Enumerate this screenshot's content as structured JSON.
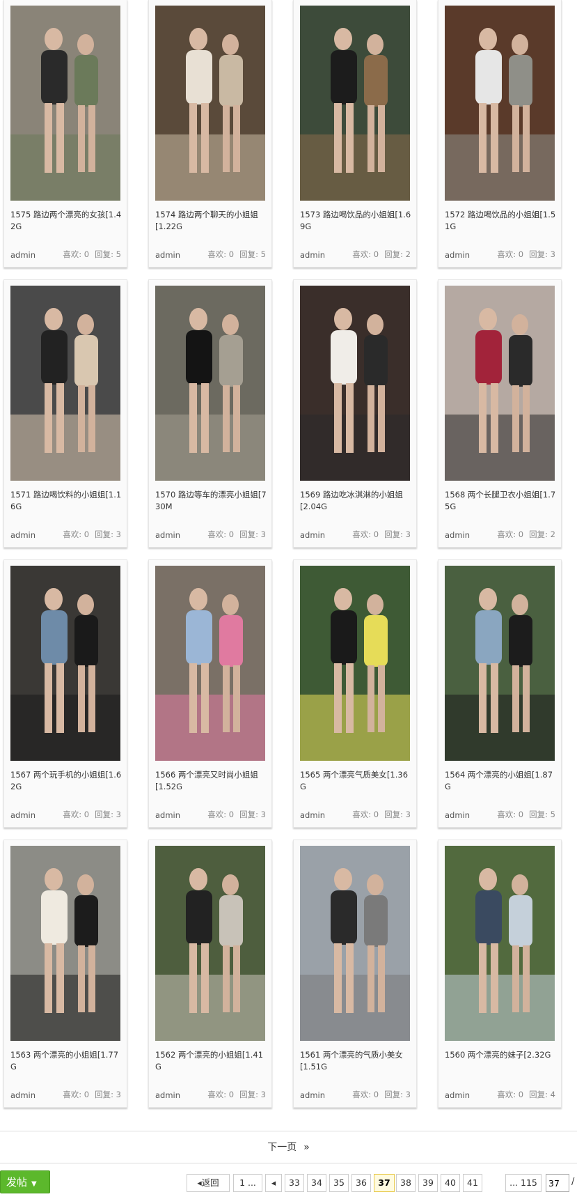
{
  "cards": [
    {
      "title": "1575 路边两个漂亮的女孩[1.42G",
      "author": "admin",
      "likes": "喜欢: 0",
      "replies": "回复: 5",
      "palette": [
        "#8a8478",
        "#2a2a2a",
        "#6b7a5a"
      ]
    },
    {
      "title": "1574 路边两个聊天的小姐姐[1.22G",
      "author": "admin",
      "likes": "喜欢: 0",
      "replies": "回复: 5",
      "palette": [
        "#5a4a3a",
        "#e8e0d4",
        "#c9b9a3"
      ]
    },
    {
      "title": "1573 路边喝饮品的小姐姐[1.69G",
      "author": "admin",
      "likes": "喜欢: 0",
      "replies": "回复: 2",
      "palette": [
        "#3d4b3a",
        "#1c1c1c",
        "#8b6b4a"
      ]
    },
    {
      "title": "1572 路边喝饮品的小姐姐[1.51G",
      "author": "admin",
      "likes": "喜欢: 0",
      "replies": "回复: 3",
      "palette": [
        "#5a3a2a",
        "#e6e6e6",
        "#8f8f88"
      ]
    },
    {
      "title": "1571 路边喝饮料的小姐姐[1.16G",
      "author": "admin",
      "likes": "喜欢: 0",
      "replies": "回复: 3",
      "palette": [
        "#4a4a4a",
        "#222222",
        "#d9c7b0"
      ]
    },
    {
      "title": "1570 路边等车的漂亮小姐姐[730M",
      "author": "admin",
      "likes": "喜欢: 0",
      "replies": "回复: 3",
      "palette": [
        "#6c6a60",
        "#141414",
        "#a59f92"
      ]
    },
    {
      "title": "1569 路边吃冰淇淋的小姐姐[2.04G",
      "author": "admin",
      "likes": "喜欢: 0",
      "replies": "回复: 3",
      "palette": [
        "#3a2e2a",
        "#f0ede8",
        "#2a2a2a"
      ]
    },
    {
      "title": "1568 两个长腿卫衣小姐姐[1.75G",
      "author": "admin",
      "likes": "喜欢: 0",
      "replies": "回复: 2",
      "palette": [
        "#b5a9a2",
        "#a2233a",
        "#2a2a2a"
      ]
    },
    {
      "title": "1567 两个玩手机的小姐姐[1.62G",
      "author": "admin",
      "likes": "喜欢: 0",
      "replies": "回复: 3",
      "palette": [
        "#3a3835",
        "#6e8ba8",
        "#1a1a1a"
      ]
    },
    {
      "title": "1566 两个漂亮又时尚小姐姐[1.52G",
      "author": "admin",
      "likes": "喜欢: 0",
      "replies": "回复: 3",
      "palette": [
        "#7a7066",
        "#9bb6d6",
        "#e07aa0"
      ]
    },
    {
      "title": "1565 两个漂亮气质美女[1.36G",
      "author": "admin",
      "likes": "喜欢: 0",
      "replies": "回复: 3",
      "palette": [
        "#3e5a35",
        "#1a1a1a",
        "#e6dc58"
      ]
    },
    {
      "title": "1564 两个漂亮的小姐姐[1.87G",
      "author": "admin",
      "likes": "喜欢: 0",
      "replies": "回复: 5",
      "palette": [
        "#4a6040",
        "#8aa6c0",
        "#1c1c1c"
      ]
    },
    {
      "title": "1563 两个漂亮的小姐姐[1.77G",
      "author": "admin",
      "likes": "喜欢: 0",
      "replies": "回复: 3",
      "palette": [
        "#8c8c86",
        "#efeae0",
        "#1c1c1c"
      ]
    },
    {
      "title": "1562 两个漂亮的小姐姐[1.41G",
      "author": "admin",
      "likes": "喜欢: 0",
      "replies": "回复: 3",
      "palette": [
        "#4e5e3e",
        "#222222",
        "#c8c2b8"
      ]
    },
    {
      "title": "1561 两个漂亮的气质小美女[1.51G",
      "author": "admin",
      "likes": "喜欢: 0",
      "replies": "回复: 3",
      "palette": [
        "#9aa1a8",
        "#2a2a2a",
        "#7a7a7a"
      ]
    },
    {
      "title": "1560 两个漂亮的妹子[2.32G",
      "author": "admin",
      "likes": "喜欢: 0",
      "replies": "回复: 4",
      "palette": [
        "#526a3e",
        "#3a4a60",
        "#c5d0da"
      ]
    }
  ],
  "next_page": {
    "label": "下一页",
    "arrow": "»"
  },
  "post_button": {
    "label": "发帖"
  },
  "pager": {
    "back_label": "返回",
    "first": "1 ...",
    "pages": [
      "33",
      "34",
      "35",
      "36",
      "37",
      "38",
      "39",
      "40",
      "41"
    ],
    "current": "37",
    "last": "... 115",
    "input_value": "37",
    "total_sep": "/"
  },
  "colors": {
    "accent_green": "#5cb82c",
    "current_page_bg": "#fffbe0"
  }
}
